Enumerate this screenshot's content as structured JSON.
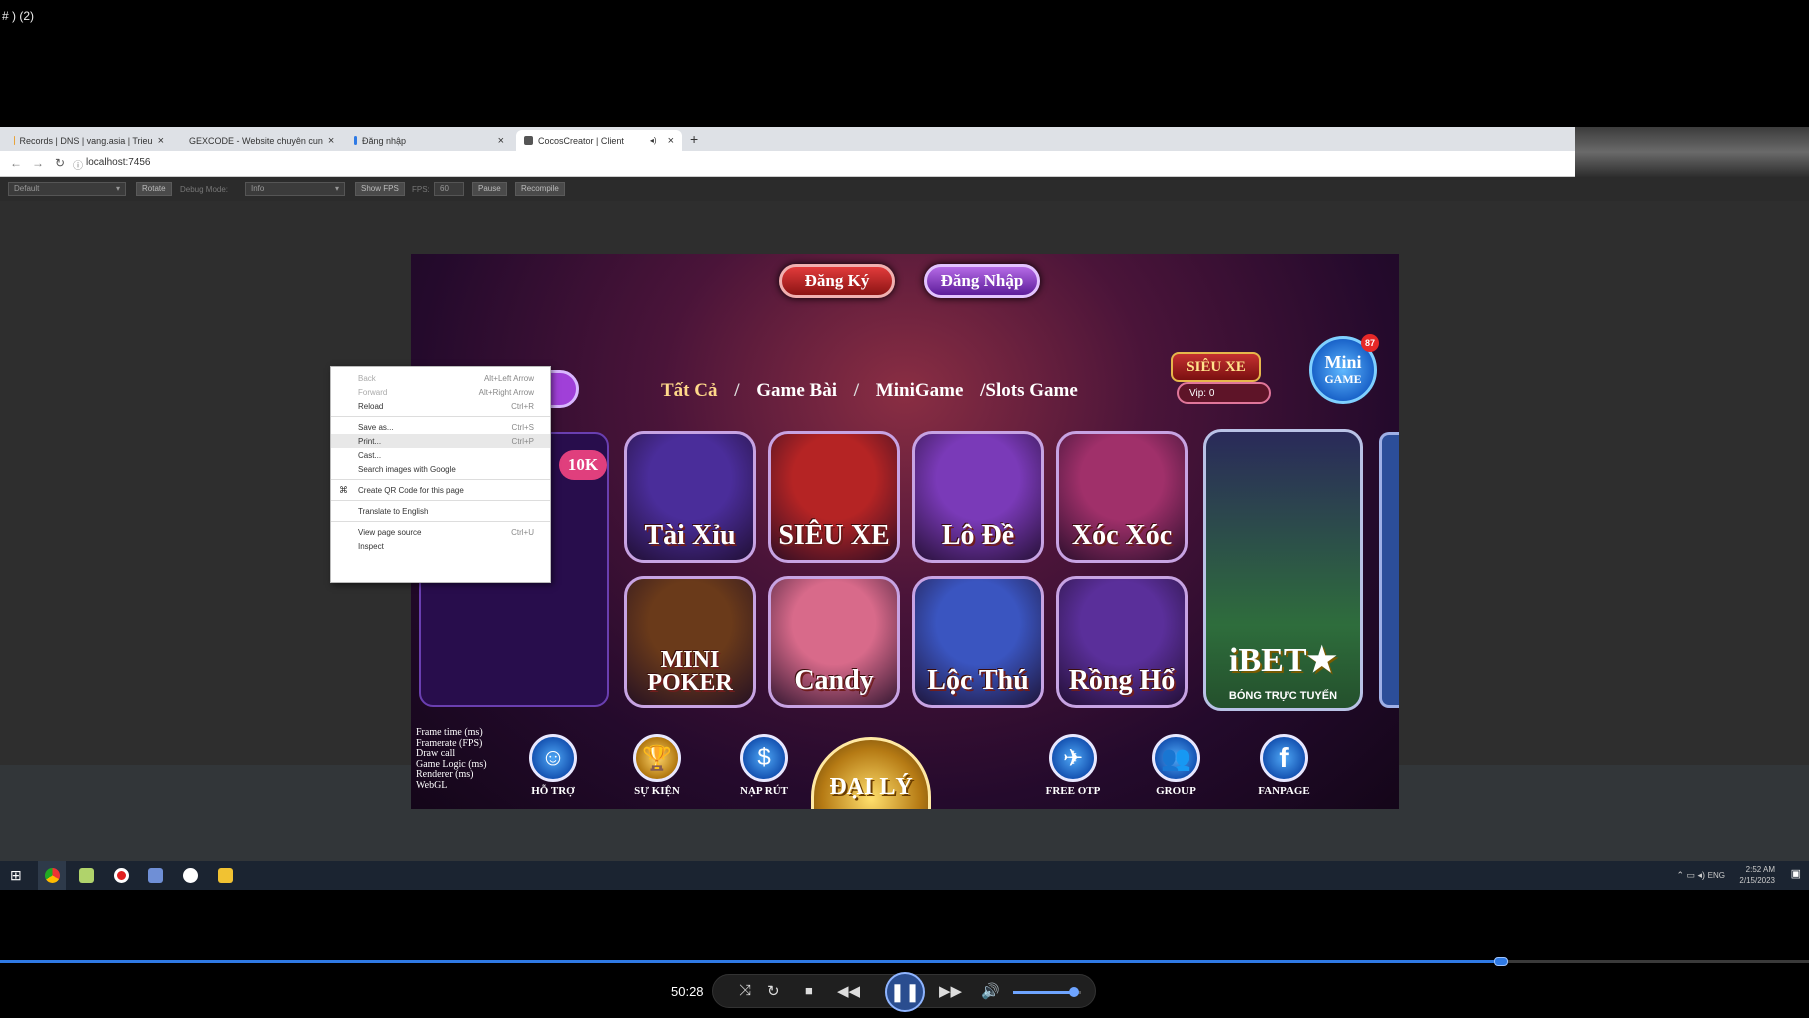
{
  "window_title": "# ) (2)",
  "browser": {
    "tabs": [
      {
        "label": "Records | DNS | vang.asia | Trieu",
        "favicon_color": "#e8a33a"
      },
      {
        "label": "GEXCODE - Website chuyên cun",
        "favicon_color": "#777777"
      },
      {
        "label": "Đăng nhập",
        "favicon_color": "#2f7ae5"
      },
      {
        "label": "CocosCreator | Client",
        "favicon_color": "#555555"
      }
    ],
    "active_tab_index": 3,
    "new_tab": "+",
    "close_glyph": "×",
    "mute_glyph": "◂)",
    "url": "localhost:7456"
  },
  "cocos_toolbar": {
    "device_select": "Default",
    "rotate": "Rotate",
    "debug_mode_label": "Debug Mode:",
    "debug_mode_select": "Info",
    "show_fps": "Show FPS",
    "fps_label": "FPS:",
    "fps_value": "60",
    "pause": "Pause",
    "recompile": "Recompile"
  },
  "game": {
    "register": "Đăng Ký",
    "login": "Đăng Nhập",
    "nav": {
      "all": "Tất Cả",
      "cards": "Game Bài",
      "mini": "MiniGame",
      "slots": "/Slots Game",
      "sep": "/"
    },
    "dollar": "$",
    "jackpot_badge": "10K",
    "sieu_xe": "SIÊU XE",
    "vip": "Vip: 0",
    "minigame": {
      "line1": "Mini",
      "line2": "GAME",
      "badge": "87"
    },
    "tiles": [
      {
        "label": "Tài Xỉu",
        "color": "#4a2d9a"
      },
      {
        "label": "SIÊU XE",
        "color": "#b52424"
      },
      {
        "label": "Lô Đề",
        "color": "#7a3ab8"
      },
      {
        "label": "Xóc Xóc",
        "color": "#a0306a"
      },
      {
        "label": "MINI POKER",
        "color": "#6a3a1a"
      },
      {
        "label": "Candy",
        "color": "#d86a8a"
      },
      {
        "label": "Lộc Thú",
        "color": "#3a55c0"
      },
      {
        "label": "Rồng Hổ",
        "color": "#5a2f9a"
      }
    ],
    "ibet": {
      "label": "iBET★",
      "sub": "BÓNG TRỰC TUYẾN"
    },
    "stats": [
      "Frame time (ms)",
      "Framerate (FPS)",
      "Draw call",
      "Game Logic (ms)",
      "Renderer (ms)",
      "WebGL"
    ],
    "bottom": [
      {
        "label": "HỖ TRỢ",
        "glyph": "☺"
      },
      {
        "label": "SỰ KIỆN",
        "glyph": "🏆"
      },
      {
        "label": "NẠP RÚT",
        "glyph": "$"
      },
      {
        "label": "FREE OTP",
        "glyph": "✈"
      },
      {
        "label": "GROUP",
        "glyph": "👥"
      },
      {
        "label": "FANPAGE",
        "glyph": "f"
      }
    ],
    "daily": "ĐẠI LÝ"
  },
  "context_menu": {
    "items": [
      {
        "label": "Back",
        "shortcut": "Alt+Left Arrow",
        "disabled": true
      },
      {
        "label": "Forward",
        "shortcut": "Alt+Right Arrow",
        "disabled": true
      },
      {
        "label": "Reload",
        "shortcut": "Ctrl+R"
      },
      {
        "label": "Save as...",
        "shortcut": "Ctrl+S"
      },
      {
        "label": "Print...",
        "shortcut": "Ctrl+P",
        "highlighted": true
      },
      {
        "label": "Cast..."
      },
      {
        "label": "Search images with Google"
      },
      {
        "label": "Create QR Code for this page"
      },
      {
        "label": "Translate to English"
      },
      {
        "label": "View page source",
        "shortcut": "Ctrl+U"
      },
      {
        "label": "Inspect"
      }
    ]
  },
  "taskbar": {
    "start_glyph": "⊞",
    "tray": {
      "lang": "ENG",
      "time": "2:52 AM",
      "date": "2/15/2023"
    }
  },
  "player": {
    "elapsed": "50:28",
    "progress": 0.83,
    "volume": 0.9
  }
}
